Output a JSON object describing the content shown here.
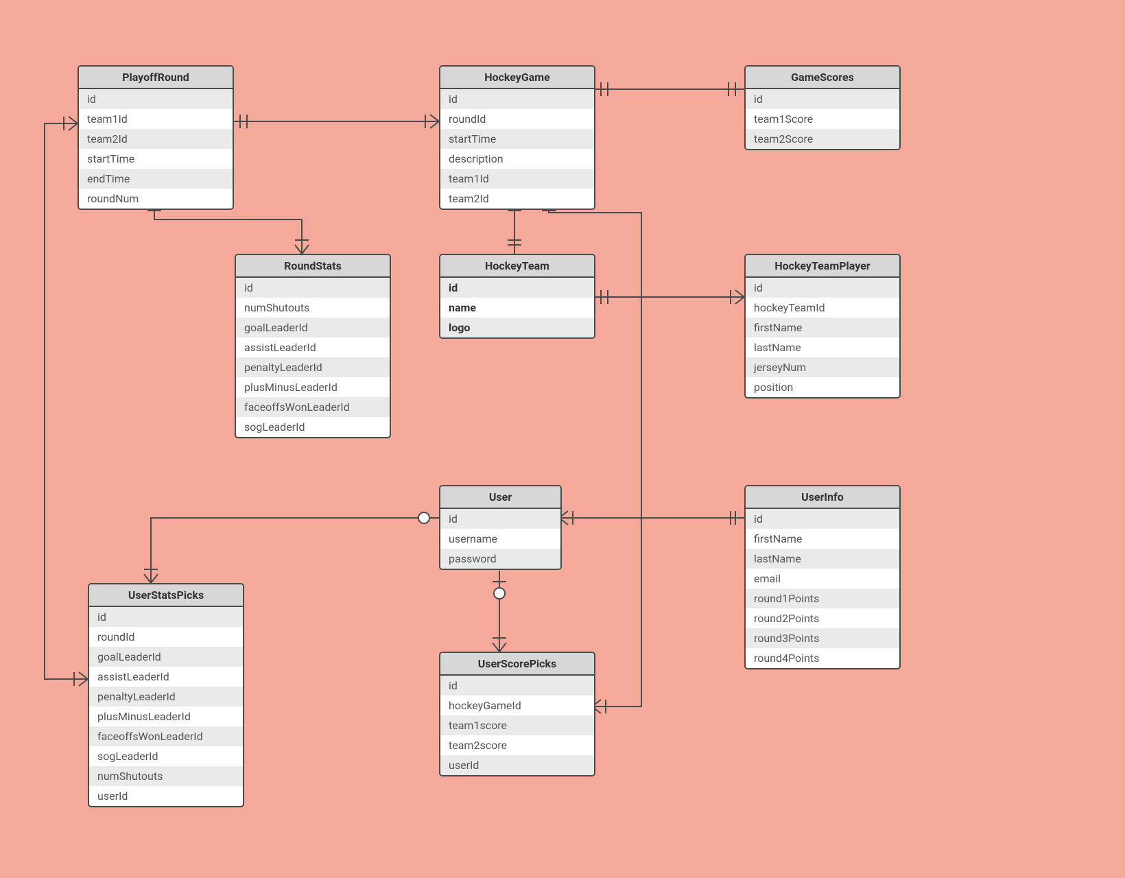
{
  "entities": {
    "playoffRound": {
      "title": "PlayoffRound",
      "fields": [
        "id",
        "team1Id",
        "team2Id",
        "startTime",
        "endTime",
        "roundNum"
      ]
    },
    "hockeyGame": {
      "title": "HockeyGame",
      "fields": [
        "id",
        "roundId",
        "startTime",
        "description",
        "team1Id",
        "team2Id"
      ]
    },
    "gameScores": {
      "title": "GameScores",
      "fields": [
        "id",
        "team1Score",
        "team2Score"
      ]
    },
    "roundStats": {
      "title": "RoundStats",
      "fields": [
        "id",
        "numShutouts",
        "goalLeaderId",
        "assistLeaderId",
        "penaltyLeaderId",
        "plusMinusLeaderId",
        "faceoffsWonLeaderId",
        "sogLeaderId"
      ]
    },
    "hockeyTeam": {
      "title": "HockeyTeam",
      "fields": [
        "id",
        "name",
        "logo"
      ]
    },
    "hockeyTeamPlayer": {
      "title": "HockeyTeamPlayer",
      "fields": [
        "id",
        "hockeyTeamId",
        "firstName",
        "lastName",
        "jerseyNum",
        "position"
      ]
    },
    "user": {
      "title": "User",
      "fields": [
        "id",
        "username",
        "password"
      ]
    },
    "userInfo": {
      "title": "UserInfo",
      "fields": [
        "id",
        "firstName",
        "lastName",
        "email",
        "round1Points",
        "round2Points",
        "round3Points",
        "round4Points"
      ]
    },
    "userStatsPicks": {
      "title": "UserStatsPicks",
      "fields": [
        "id",
        "roundId",
        "goalLeaderId",
        "assistLeaderId",
        "penaltyLeaderId",
        "plusMinusLeaderId",
        "faceoffsWonLeaderId",
        "sogLeaderId",
        "numShutouts",
        "userId"
      ]
    },
    "userScorePicks": {
      "title": "UserScorePicks",
      "fields": [
        "id",
        "hockeyGameId",
        "team1score",
        "team2score",
        "userId"
      ]
    }
  }
}
